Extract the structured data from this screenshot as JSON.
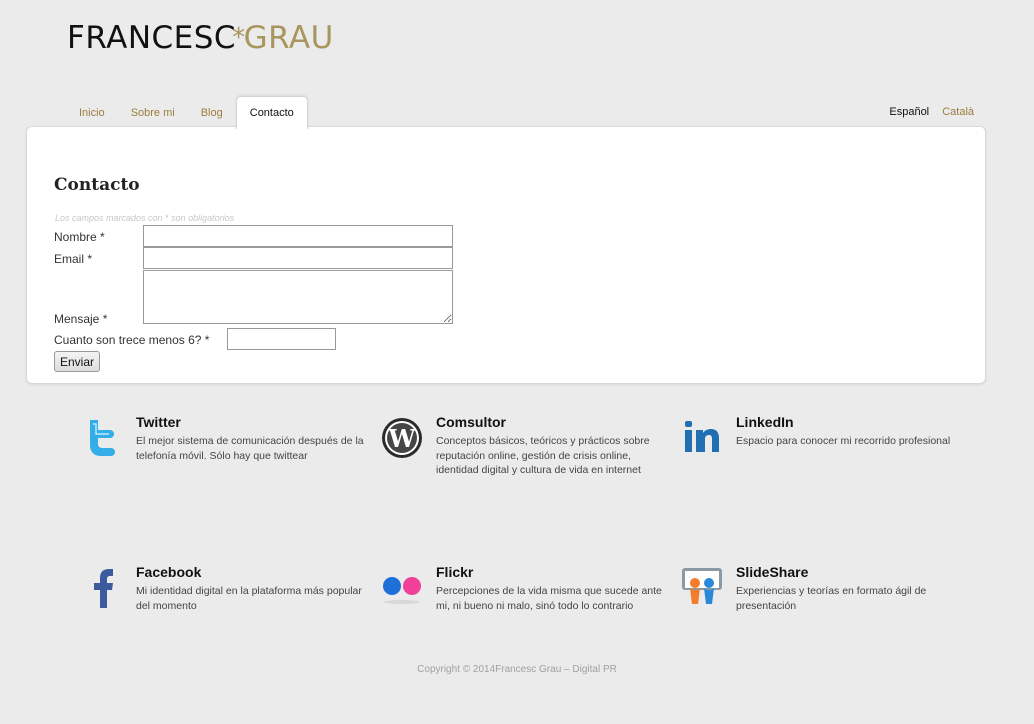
{
  "logo": {
    "first": "FRANCESC",
    "star": "*",
    "last": "GRAU"
  },
  "nav": {
    "tabs": [
      "Inicio",
      "Sobre mi",
      "Blog",
      "Contacto"
    ],
    "active": "Contacto"
  },
  "lang": {
    "current": "Español",
    "other": "Català"
  },
  "form": {
    "title": "Contacto",
    "note": "Los campos marcados con * son obligatorios",
    "name_label": "Nombre *",
    "email_label": "Email *",
    "message_label": "Mensaje *",
    "captcha_label": "Cuanto son trece menos 6? *",
    "name_value": "",
    "email_value": "",
    "message_value": "",
    "captcha_value": "",
    "submit_label": "Enviar"
  },
  "social": [
    {
      "title": "Twitter",
      "desc": "El mejor sistema de comunicación después de la telefonía móvil. Sólo hay que twittear",
      "icon": "twitter-icon"
    },
    {
      "title": "Comsultor",
      "desc": "Conceptos básicos, teóricos y prácticos sobre reputación online, gestión de crisis online, identidad digital y cultura de vida en internet",
      "icon": "wordpress-icon"
    },
    {
      "title": "LinkedIn",
      "desc": "Espacio para conocer mi recorrido profesional",
      "icon": "linkedin-icon"
    },
    {
      "title": "Facebook",
      "desc": "Mi identidad digital en la plataforma más popular del momento",
      "icon": "facebook-icon"
    },
    {
      "title": "Flickr",
      "desc": "Percepciones de la vida misma que sucede ante mi, ni bueno ni malo, sinó todo lo contrario",
      "icon": "flickr-icon"
    },
    {
      "title": "SlideShare",
      "desc": "Experiencias y teorías en formato ágil de presentación",
      "icon": "slideshare-icon"
    }
  ],
  "footer": {
    "copyright": "Copyright © 2014Francesc Grau – Digital PR"
  },
  "colors": {
    "accent": "#a8965e",
    "link": "#9b7e3e",
    "background": "#ebebeb"
  }
}
